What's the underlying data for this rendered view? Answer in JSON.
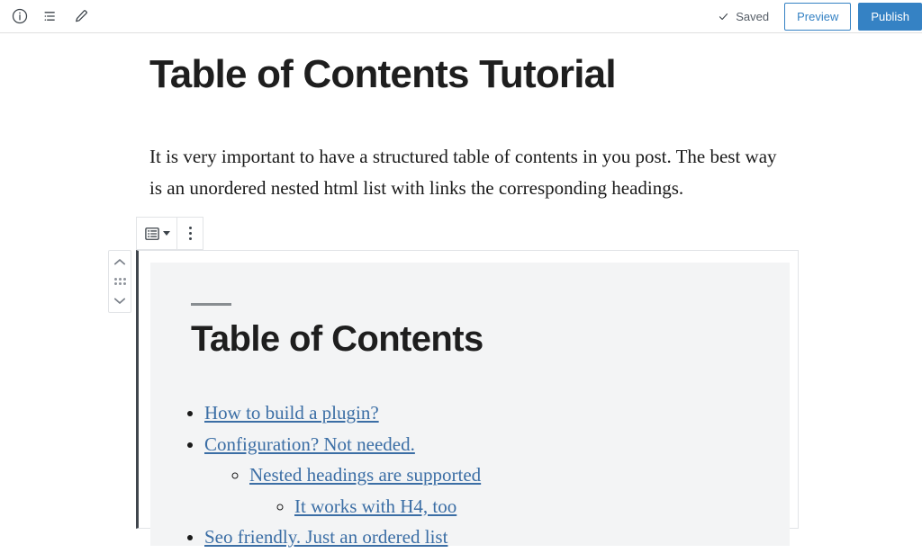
{
  "header": {
    "left_tools": [
      {
        "name": "info-icon",
        "label": "Details"
      },
      {
        "name": "list-view-icon",
        "label": "List view"
      },
      {
        "name": "pencil-icon",
        "label": "Edit"
      }
    ],
    "save_status": "Saved",
    "preview_label": "Preview",
    "publish_label": "Publish",
    "accent_color": "#3582c4"
  },
  "post": {
    "title": "Table of Contents Tutorial",
    "paragraph": "It is very important to have a structured table of contents in you post. The best way is an unordered nested html list with links the corresponding headings."
  },
  "block_toolbar": {
    "block_type_label": "List",
    "more_options_label": "Options"
  },
  "block_mover": {
    "move_up_label": "Move up",
    "drag_label": "Drag",
    "move_down_label": "Move down"
  },
  "toc_block": {
    "heading": "Table of Contents",
    "items": [
      {
        "label": "How to build a plugin?",
        "children": []
      },
      {
        "label": "Configuration? Not needed.",
        "children": [
          {
            "label": "Nested headings are supported",
            "children": [
              {
                "label": "It works with H4, too",
                "children": []
              }
            ]
          }
        ]
      },
      {
        "label": "Seo friendly. Just an ordered list",
        "children": []
      }
    ],
    "link_color": "#3b6ea5",
    "panel_bg": "#f3f4f5"
  }
}
